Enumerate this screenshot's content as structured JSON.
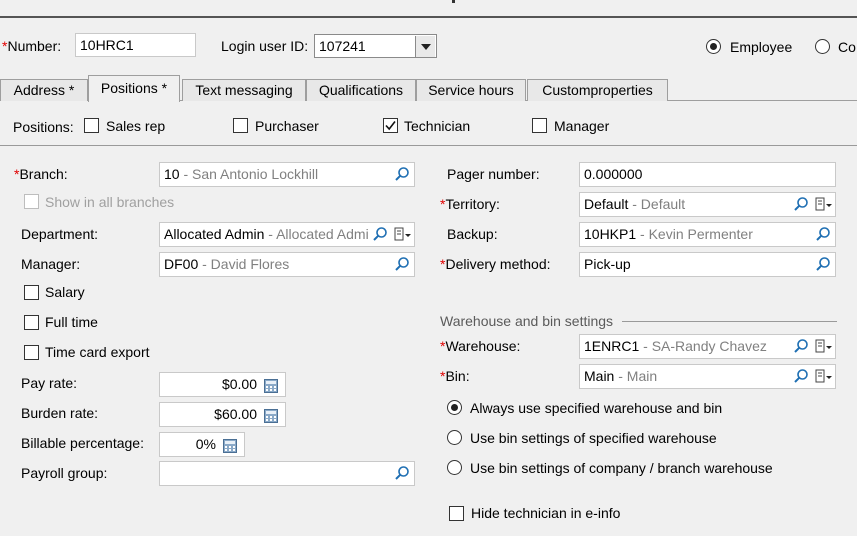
{
  "header": {
    "number_label": "Number:",
    "number_value": "10HRC1",
    "login_label": "Login user ID:",
    "login_value": "107241",
    "radio_employee": "Employee",
    "radio_contractor": "Co"
  },
  "tabs": [
    {
      "label": "Address *"
    },
    {
      "label": "Positions *"
    },
    {
      "label": "Text messaging"
    },
    {
      "label": "Qualifications"
    },
    {
      "label": "Service hours"
    },
    {
      "label": "Customproperties"
    }
  ],
  "positions": {
    "label": "Positions:",
    "items": [
      {
        "label": "Sales rep",
        "checked": false
      },
      {
        "label": "Purchaser",
        "checked": false
      },
      {
        "label": "Technician",
        "checked": true
      },
      {
        "label": "Manager",
        "checked": false
      }
    ]
  },
  "left": {
    "branch_label": "Branch:",
    "branch_code": "10",
    "branch_name": " - San Antonio Lockhill",
    "show_all_branches": "Show in all branches",
    "department_label": "Department:",
    "department_code": "Allocated Admin",
    "department_name": " - Allocated Admi",
    "manager_label": "Manager:",
    "manager_code": "DF00",
    "manager_name": " - David Flores",
    "salary": "Salary",
    "full_time": "Full time",
    "time_card_export": "Time card export",
    "pay_rate_label": "Pay rate:",
    "pay_rate_value": "$0.00",
    "burden_rate_label": "Burden rate:",
    "burden_rate_value": "$60.00",
    "billable_label": "Billable percentage:",
    "billable_value": "0%",
    "payroll_label": "Payroll group:",
    "payroll_value": ""
  },
  "right": {
    "pager_label": "Pager number:",
    "pager_value": "0.000000",
    "territory_label": "Territory:",
    "territory_code": "Default",
    "territory_name": " - Default",
    "backup_label": "Backup:",
    "backup_code": "10HKP1",
    "backup_name": " - Kevin Permenter",
    "delivery_label": "Delivery method:",
    "delivery_value": "Pick-up",
    "warehouse_section": "Warehouse and bin settings",
    "warehouse_label": "Warehouse:",
    "warehouse_code": "1ENRC1",
    "warehouse_name": " - SA-Randy Chavez",
    "bin_label": "Bin:",
    "bin_code": "Main",
    "bin_name": " - Main",
    "option_always": "Always use specified warehouse and bin",
    "option_specified": "Use bin settings of specified warehouse",
    "option_company": "Use bin settings of company / branch warehouse",
    "hide_technician": "Hide technician in e-info"
  },
  "icons": {
    "lookup": "magnifier-icon",
    "menu": "document-dropdown-icon",
    "calculator": "calculator-icon"
  }
}
